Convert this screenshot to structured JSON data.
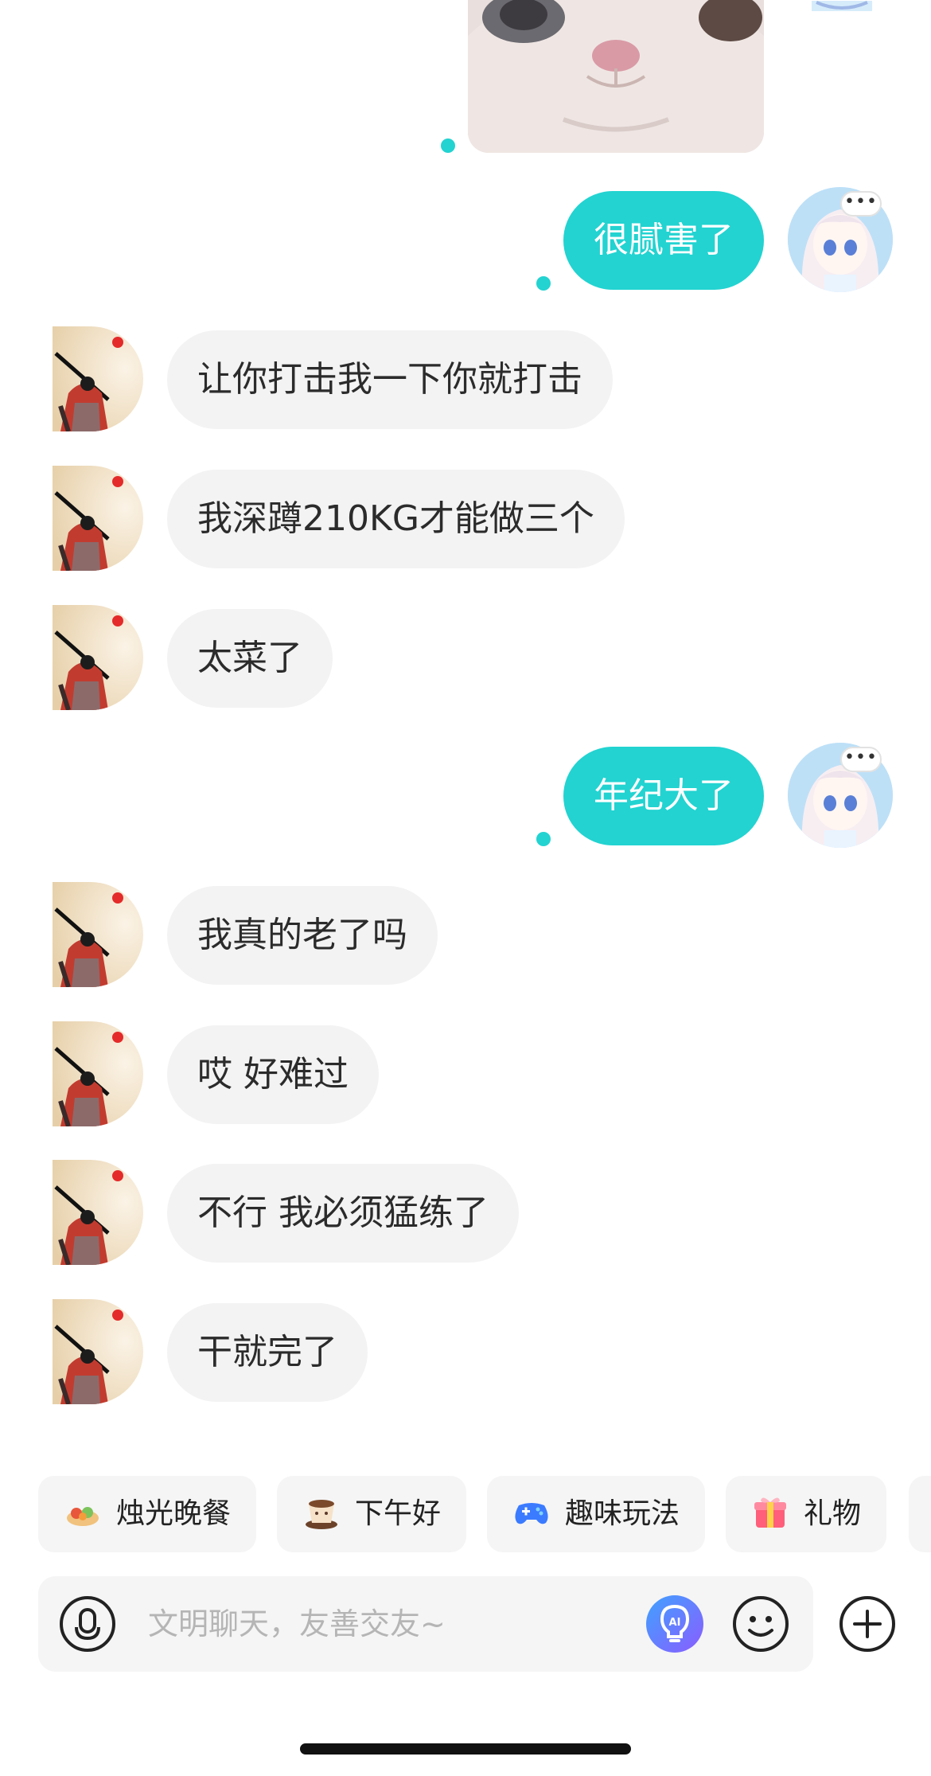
{
  "messages": [
    {
      "side": "right",
      "text": "很腻害了"
    },
    {
      "side": "left",
      "text": "让你打击我一下你就打击"
    },
    {
      "side": "left",
      "text": "我深蹲210KG才能做三个"
    },
    {
      "side": "left",
      "text": "太菜了"
    },
    {
      "side": "right",
      "text": "年纪大了"
    },
    {
      "side": "left",
      "text": "我真的老了吗"
    },
    {
      "side": "left",
      "text": "哎 好难过"
    },
    {
      "side": "left",
      "text": "不行 我必须猛练了"
    },
    {
      "side": "left",
      "text": "干就完了"
    }
  ],
  "more_glyph": "•••",
  "quick_actions": [
    {
      "label": "烛光晚餐",
      "icon": "candle-dinner-icon"
    },
    {
      "label": "下午好",
      "icon": "coffee-cup-icon"
    },
    {
      "label": "趣味玩法",
      "icon": "gamepad-icon"
    },
    {
      "label": "礼物",
      "icon": "gift-icon"
    }
  ],
  "input": {
    "placeholder": "文明聊天，友善交友~"
  },
  "colors": {
    "accent": "#22d3d1",
    "bubble_left": "#f3f3f3",
    "ai_button": "#6a5cff"
  }
}
